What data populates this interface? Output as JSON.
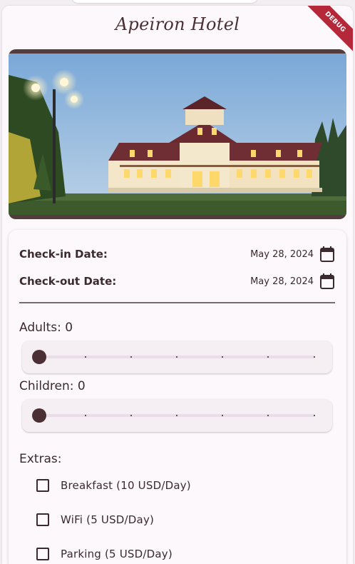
{
  "app": {
    "title": "Apeiron Hotel",
    "debug_banner": "DEBUG"
  },
  "hero": {
    "image": "hotel-photo"
  },
  "booking": {
    "checkin": {
      "label": "Check-in Date:",
      "value": "May 28, 2024",
      "icon": "calendar-icon"
    },
    "checkout": {
      "label": "Check-out Date:",
      "value": "May 28, 2024",
      "icon": "calendar-icon"
    },
    "adults": {
      "label": "Adults: 0",
      "value": 0
    },
    "children": {
      "label": "Children: 0",
      "value": 0
    },
    "extras": {
      "label": "Extras:",
      "items": [
        {
          "label": "Breakfast (10 USD/Day)",
          "checked": false
        },
        {
          "label": "WiFi (5 USD/Day)",
          "checked": false
        },
        {
          "label": "Parking (5 USD/Day)",
          "checked": false
        }
      ]
    }
  },
  "colors": {
    "accent": "#4a3034",
    "banner": "#b4283a",
    "background": "#fdf8fb"
  }
}
